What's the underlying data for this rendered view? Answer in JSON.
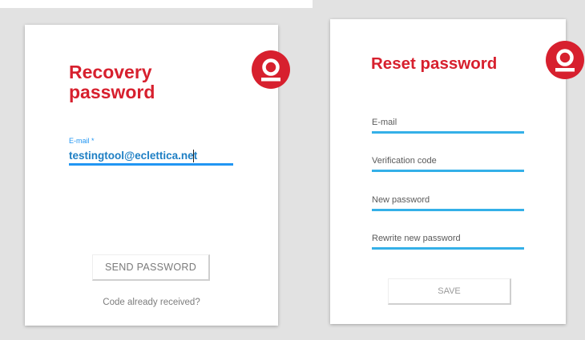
{
  "recovery": {
    "title": "Recovery password",
    "email_label": "E-mail *",
    "email_value": "testingtool@eclettica.net",
    "send_button": "SEND PASSWORD",
    "code_link": "Code already received?"
  },
  "reset": {
    "title": "Reset password",
    "fields": [
      {
        "label": "E-mail"
      },
      {
        "label": "Verification code"
      },
      {
        "label": "New password"
      },
      {
        "label": "Rewrite new password"
      }
    ],
    "save_button": "SAVE"
  },
  "colors": {
    "brand_red": "#d7202e",
    "active_blue": "#2196f3",
    "underline_blue": "#34b0e8",
    "background": "#e2e2e2"
  },
  "icons": {
    "logo": "user-avatar-logo-icon"
  }
}
